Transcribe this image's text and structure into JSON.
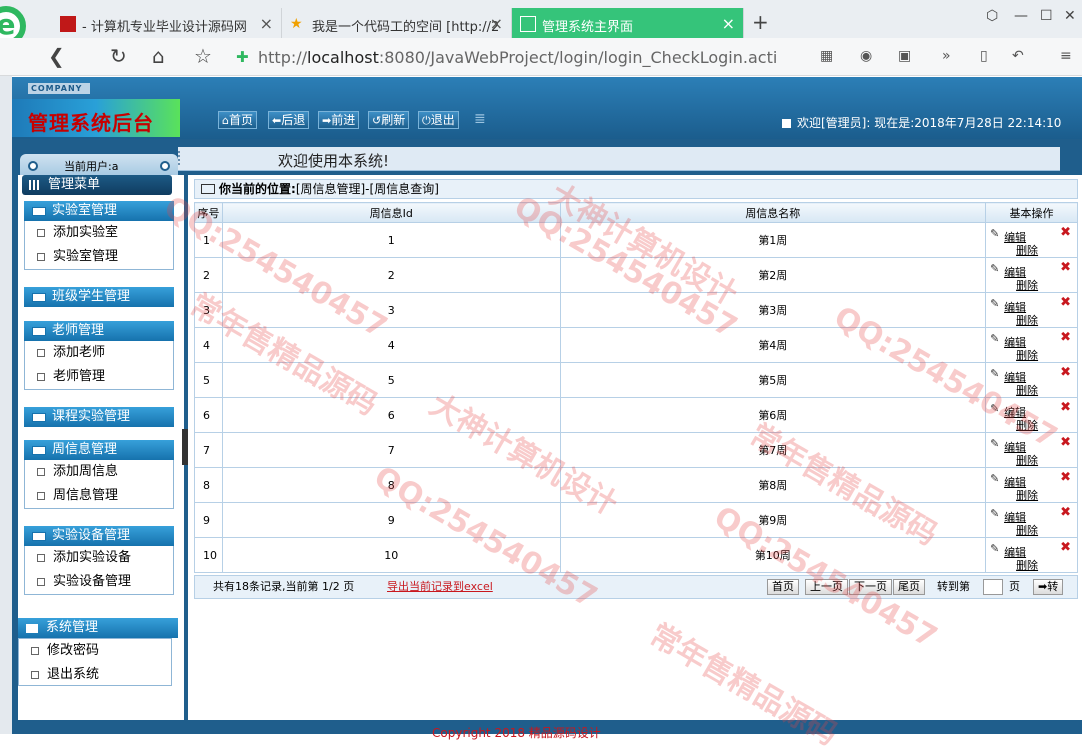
{
  "browser": {
    "tabs": [
      {
        "title": "- 计算机专业毕业设计源码网",
        "close": "×"
      },
      {
        "title": "我是一个代码工的空间 [http://2",
        "close": "×"
      },
      {
        "title": "管理系统主界面",
        "close": "×"
      }
    ],
    "new_tab": "+",
    "url_host": "localhost",
    "url_rest": ":8080/JavaWebProject/login/login_CheckLogin.acti",
    "url_prefix": "http://",
    "more": "»"
  },
  "header": {
    "company": "COMPANY",
    "title": "管理系统后台",
    "buttons": [
      {
        "icon": "home-icon",
        "label": "首页"
      },
      {
        "icon": "back-icon",
        "label": "后退"
      },
      {
        "icon": "forward-icon",
        "label": "前进"
      },
      {
        "icon": "refresh-icon",
        "label": "刷新"
      },
      {
        "icon": "power-icon",
        "label": "退出"
      }
    ],
    "welcome": "欢迎[管理员]:  现在是:2018年7月28日 22:14:10"
  },
  "user_bar": {
    "label": "当前用户:a"
  },
  "welcome_bar": "欢迎使用本系统!",
  "sidebar": {
    "menu_title": "管理菜单",
    "sections": [
      {
        "title": "实验室管理",
        "items": [
          "添加实验室",
          "实验室管理"
        ]
      },
      {
        "title": "班级学生管理",
        "items": []
      },
      {
        "title": "老师管理",
        "items": [
          "添加老师",
          "老师管理"
        ]
      },
      {
        "title": "课程实验管理",
        "items": []
      },
      {
        "title": "周信息管理",
        "items": [
          "添加周信息",
          "周信息管理"
        ]
      },
      {
        "title": "实验设备管理",
        "items": [
          "添加实验设备",
          "实验设备管理"
        ]
      }
    ],
    "system": {
      "title": "系统管理",
      "items": [
        "修改密码",
        "退出系统"
      ]
    }
  },
  "location": {
    "prefix": "你当前的位置:",
    "path": "[周信息管理]-[周信息查询]"
  },
  "table": {
    "headers": [
      "序号",
      "周信息Id",
      "周信息名称",
      "基本操作"
    ],
    "rows": [
      [
        "1",
        "1",
        "第1周"
      ],
      [
        "2",
        "2",
        "第2周"
      ],
      [
        "3",
        "3",
        "第3周"
      ],
      [
        "4",
        "4",
        "第4周"
      ],
      [
        "5",
        "5",
        "第5周"
      ],
      [
        "6",
        "6",
        "第6周"
      ],
      [
        "7",
        "7",
        "第7周"
      ],
      [
        "8",
        "8",
        "第8周"
      ],
      [
        "9",
        "9",
        "第9周"
      ],
      [
        "10",
        "10",
        "第10周"
      ]
    ],
    "edit_label": "编辑",
    "delete_label": "删除"
  },
  "pager": {
    "info": "共有18条记录,当前第 1/2 页",
    "export": "导出当前记录到excel",
    "first": "首页",
    "prev": "上一页",
    "next": "下一页",
    "last": "尾页",
    "goto_label": "转到第",
    "page_unit": "页",
    "go_button": "转"
  },
  "footer": "Copyright 2018 精品源码设计",
  "watermark": [
    "QQ:254540457",
    "大神计算机设计",
    "常年售精品源码"
  ],
  "colors": {
    "accent": "#1f5e8c",
    "active_tab": "#35c47a",
    "title_red": "#c80000",
    "link_red": "#c8181e"
  }
}
